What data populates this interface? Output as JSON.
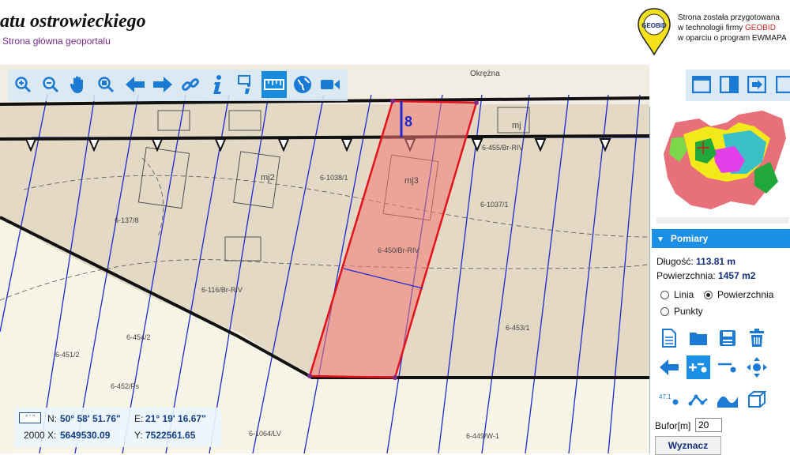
{
  "header": {
    "title": "atu ostrowieckiego",
    "home_link": "Strona główna geoportalu",
    "logo_text": "GEOBID",
    "vendor_line1": "Strona została przygotowana",
    "vendor_line2_prefix": "w technologii firmy ",
    "vendor_brand": "GEOBID",
    "vendor_line3": "w oparciu o program EWMAPA"
  },
  "toolbar": {
    "tools": [
      "zoom-in-icon",
      "zoom-out-icon",
      "pan-hand-icon",
      "zoom-window-icon",
      "back-arrow-icon",
      "forward-arrow-icon",
      "link-icon",
      "info-icon",
      "info-select-icon",
      "measure-ruler-icon",
      "globe-icon",
      "video-camera-icon"
    ],
    "active_tool": "measure-ruler-icon"
  },
  "right_tools": [
    "window-maximize-icon",
    "split-view-icon",
    "export-icon",
    "panel-toggle-icon"
  ],
  "map_labels": {
    "parcel_a": "6-137/8",
    "parcel_b": "6-116/Br-RIV",
    "parcel_c": "6-1038/1",
    "parcel_d": "6-1037/1",
    "parcel_e": "6-453/1",
    "parcel_f": "6-452/Ps",
    "parcel_g": "6-1064/LV",
    "parcel_h": "6-449/W-1",
    "parcel_i": "6-450/Br-RIV",
    "parcel_j": "6-455/Br-RIV",
    "parcel_k": "6-454/2",
    "parcel_l": "6-451/2",
    "road": "Okrężna",
    "building_a": "mj2",
    "building_b": "mj3",
    "building_c": "mj",
    "number_a": "8"
  },
  "coords": {
    "format_label": "° ' \"",
    "n_label": "N:",
    "n_value": "50° 58' 51.76\"",
    "e_label": "E:",
    "e_value": "21° 19' 16.67\"",
    "x_label": "2000 X:",
    "x_value": "5649530.09",
    "y_label": "Y:",
    "y_value": "7522561.65"
  },
  "panel": {
    "section_title": "Pomiary",
    "length_label": "Długość:",
    "length_value": "113.81 m",
    "area_label": "Powierzchnia:",
    "area_value": "1457 m2",
    "options": [
      "Linia",
      "Powierzchnia",
      "Punkty"
    ],
    "selected_option": "Powierzchnia",
    "buttons": [
      "new-document-icon",
      "open-folder-icon",
      "save-disk-icon",
      "trash-icon",
      "back-arrow-icon",
      "add-point-icon",
      "remove-point-icon",
      "move-point-icon",
      "label-value-icon",
      "polyline-icon",
      "curve-icon",
      "cube-3d-icon"
    ],
    "active_button": "add-point-icon",
    "buffer_label": "Bufor[m]",
    "buffer_value": "20",
    "compute_button": "Wyznacz"
  },
  "colors": {
    "accent": "#1b8ee6",
    "selection_fill": "#f2a7a0",
    "selection_stroke": "#e5111b"
  }
}
